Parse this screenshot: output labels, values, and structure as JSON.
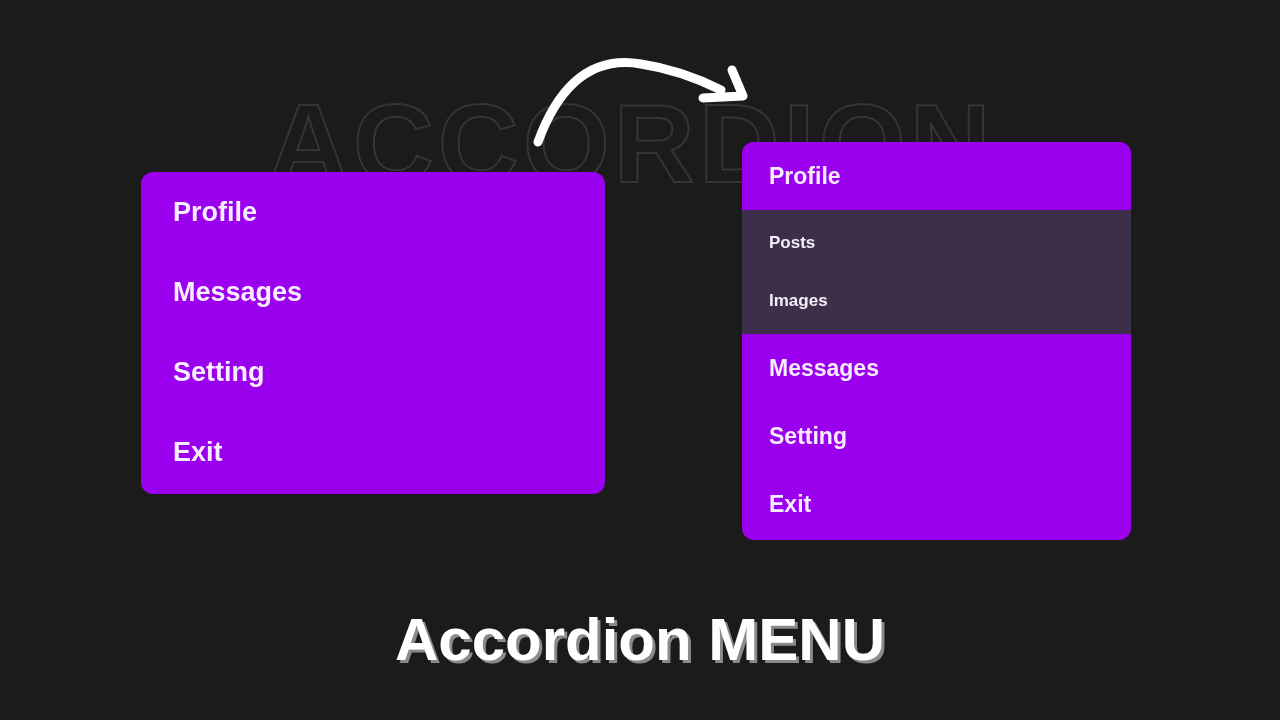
{
  "backdrop_title": "ACCORDION",
  "menus": [
    {
      "items": [
        {
          "label": "Profile",
          "expanded": false
        },
        {
          "label": "Messages"
        },
        {
          "label": "Setting"
        },
        {
          "label": "Exit"
        }
      ]
    },
    {
      "items": [
        {
          "label": "Profile",
          "expanded": true,
          "children": [
            {
              "label": "Posts"
            },
            {
              "label": "Images"
            }
          ]
        },
        {
          "label": "Messages"
        },
        {
          "label": "Setting"
        },
        {
          "label": "Exit"
        }
      ]
    }
  ],
  "title": "Accordion MENU"
}
